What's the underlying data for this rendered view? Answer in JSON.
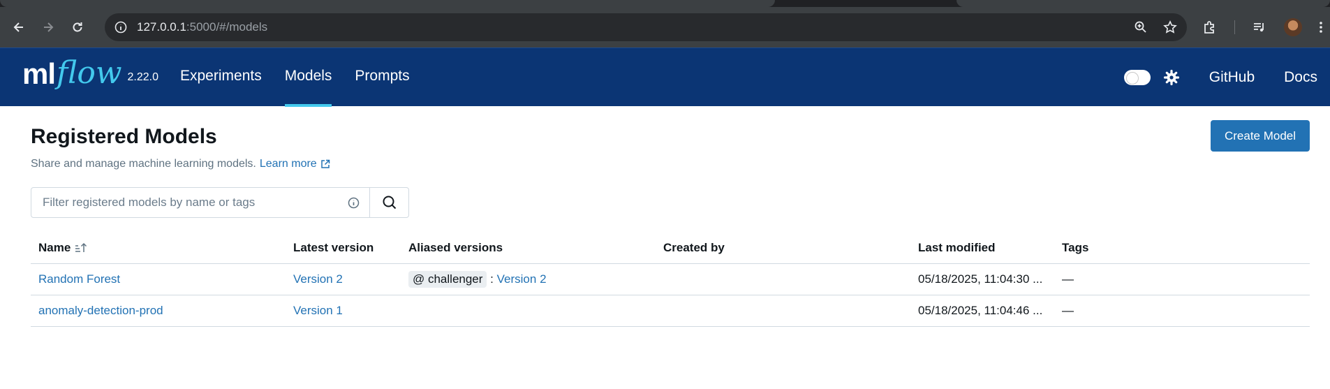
{
  "browser": {
    "url_host": "127.0.0.1",
    "url_rest": ":5000/#/models"
  },
  "header": {
    "logo_ml": "ml",
    "logo_flow": "flow",
    "version": "2.22.0",
    "nav": [
      {
        "label": "Experiments"
      },
      {
        "label": "Models"
      },
      {
        "label": "Prompts"
      }
    ],
    "github": "GitHub",
    "docs": "Docs"
  },
  "page": {
    "title": "Registered Models",
    "subtitle": "Share and manage machine learning models.",
    "learn_more": "Learn more",
    "create_button": "Create Model",
    "search_placeholder": "Filter registered models by name or tags"
  },
  "table": {
    "columns": [
      "Name",
      "Latest version",
      "Aliased versions",
      "Created by",
      "Last modified",
      "Tags"
    ],
    "rows": [
      {
        "name": "Random Forest",
        "latest_version": "Version 2",
        "alias": "@ challenger",
        "alias_sep": ":",
        "alias_version": "Version 2",
        "created_by": "",
        "last_modified": "05/18/2025, 11:04:30 ...",
        "tags": "—"
      },
      {
        "name": "anomaly-detection-prod",
        "latest_version": "Version 1",
        "alias": "",
        "alias_sep": "",
        "alias_version": "",
        "created_by": "",
        "last_modified": "05/18/2025, 11:04:46 ...",
        "tags": "—"
      }
    ]
  },
  "colors": {
    "header_bg": "#0b3574",
    "accent": "#43c9ed",
    "link": "#2272b4",
    "primary_button": "#2272b4"
  }
}
